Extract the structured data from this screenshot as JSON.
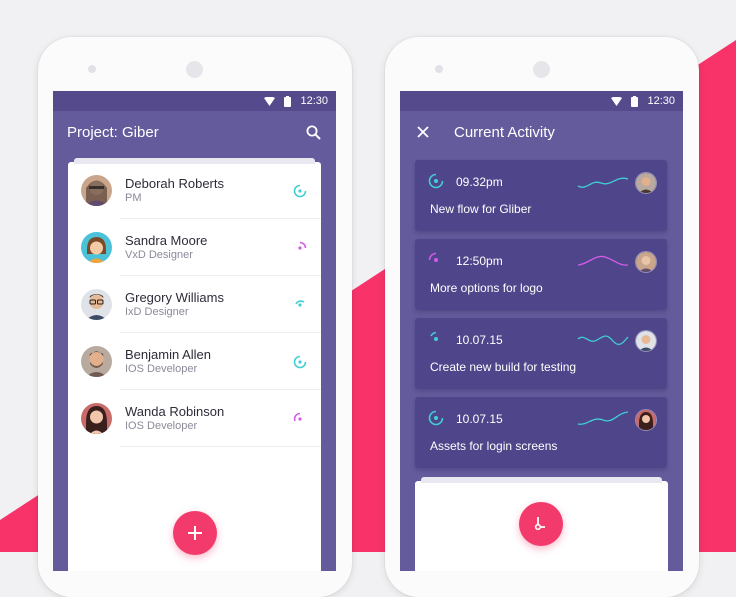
{
  "colors": {
    "primary": "#645b9c",
    "primary_dark": "#544a8c",
    "card": "#4f458a",
    "accent": "#f23a6c",
    "teal": "#3fd0d4",
    "magenta": "#d45be6"
  },
  "statusbar": {
    "time": "12:30",
    "icons": [
      "wifi-icon",
      "battery-icon"
    ]
  },
  "left_screen": {
    "title": "Project: Giber",
    "search_icon": "search-icon",
    "contacts": [
      {
        "name": "Deborah Roberts",
        "role": "PM",
        "status_color": "teal"
      },
      {
        "name": "Sandra Moore",
        "role": "VxD Designer",
        "status_color": "magenta"
      },
      {
        "name": "Gregory Williams",
        "role": "IxD Designer",
        "status_color": "teal"
      },
      {
        "name": "Benjamin Allen",
        "role": "IOS Developer",
        "status_color": "teal"
      },
      {
        "name": "Wanda Robinson",
        "role": "IOS Developer",
        "status_color": "magenta"
      }
    ],
    "fab_icon": "plus-icon"
  },
  "right_screen": {
    "title": "Current Activity",
    "close_icon": "close-icon",
    "activities": [
      {
        "time": "09.32pm",
        "desc": "New flow for Gliber",
        "color": "teal"
      },
      {
        "time": "12:50pm",
        "desc": "More options for logo",
        "color": "magenta"
      },
      {
        "time": "10.07.15",
        "desc": "Create new build for testing",
        "color": "teal"
      },
      {
        "time": "10.07.15",
        "desc": "Assets for login screens",
        "color": "teal"
      }
    ],
    "fab_icon": "timer-icon"
  }
}
